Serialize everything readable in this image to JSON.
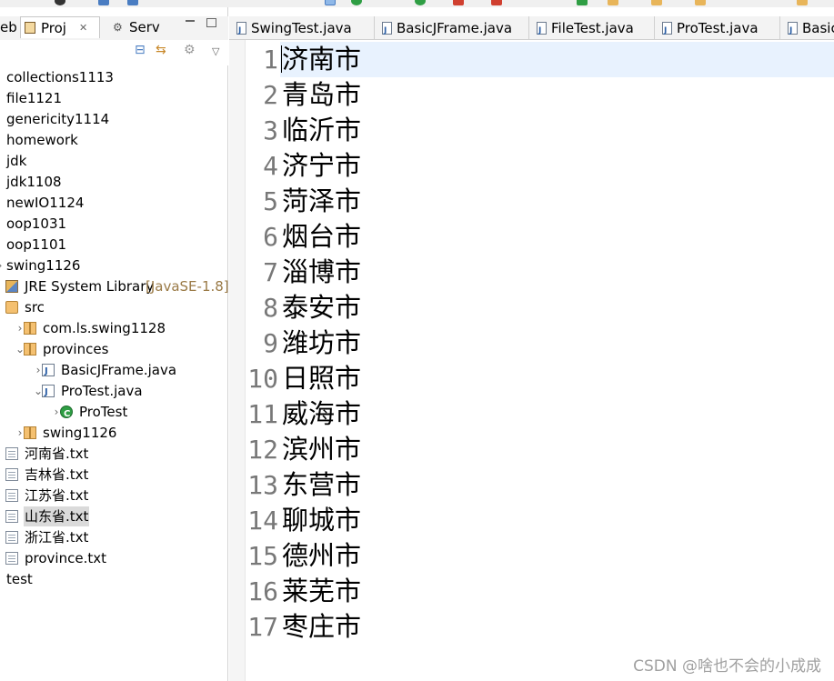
{
  "left_panel": {
    "tabs": [
      {
        "label": "eb"
      },
      {
        "label": "Proj",
        "close": "✕"
      },
      {
        "label": "Serv"
      }
    ],
    "tree": [
      {
        "label": "collections1113",
        "indent": 0,
        "icon": "none"
      },
      {
        "label": "file1121",
        "indent": 0,
        "icon": "none"
      },
      {
        "label": "genericity1114",
        "indent": 0,
        "icon": "none"
      },
      {
        "label": "homework",
        "indent": 0,
        "icon": "none"
      },
      {
        "label": "jdk",
        "indent": 0,
        "icon": "none"
      },
      {
        "label": "jdk1108",
        "indent": 0,
        "icon": "none"
      },
      {
        "label": "newIO1124",
        "indent": 0,
        "icon": "none"
      },
      {
        "label": "oop1031",
        "indent": 0,
        "icon": "none"
      },
      {
        "label": "oop1101",
        "indent": 0,
        "icon": "none"
      },
      {
        "label": "swing1126",
        "indent": 0,
        "icon": "none",
        "chevron": "›"
      },
      {
        "label": "JRE System Library",
        "decor": "[JavaSE-1.8]",
        "indent": 0,
        "icon": "library-icon"
      },
      {
        "label": "src",
        "indent": 0,
        "icon": "source-folder-icon"
      },
      {
        "label": "com.ls.swing1128",
        "indent": 1,
        "icon": "package-icon",
        "chevron": "›"
      },
      {
        "label": "provinces",
        "indent": 1,
        "icon": "package-icon",
        "chevron": "⌄"
      },
      {
        "label": "BasicJFrame.java",
        "indent": 2,
        "icon": "java-file-icon",
        "chevron": "›"
      },
      {
        "label": "ProTest.java",
        "indent": 2,
        "icon": "java-file-icon",
        "chevron": "⌄"
      },
      {
        "label": "ProTest",
        "indent": 3,
        "icon": "class-icon",
        "chevron": "›"
      },
      {
        "label": "swing1126",
        "indent": 1,
        "icon": "package-icon",
        "chevron": "›"
      },
      {
        "label": "河南省.txt",
        "indent": 0,
        "icon": "text-file-icon"
      },
      {
        "label": "吉林省.txt",
        "indent": 0,
        "icon": "text-file-icon"
      },
      {
        "label": "江苏省.txt",
        "indent": 0,
        "icon": "text-file-icon"
      },
      {
        "label": "山东省.txt",
        "indent": 0,
        "icon": "text-file-icon",
        "selected": true
      },
      {
        "label": "浙江省.txt",
        "indent": 0,
        "icon": "text-file-icon"
      },
      {
        "label": "province.txt",
        "indent": 0,
        "icon": "text-file-icon"
      },
      {
        "label": "test",
        "indent": 0,
        "icon": "none"
      }
    ]
  },
  "editor": {
    "tabs": [
      {
        "label": "SwingTest.java"
      },
      {
        "label": "BasicJFrame.java"
      },
      {
        "label": "FileTest.java"
      },
      {
        "label": "ProTest.java"
      },
      {
        "label": "Basic"
      }
    ],
    "lines": [
      {
        "num": "1",
        "text": "济南市"
      },
      {
        "num": "2",
        "text": "青岛市"
      },
      {
        "num": "3",
        "text": "临沂市"
      },
      {
        "num": "4",
        "text": "济宁市"
      },
      {
        "num": "5",
        "text": "菏泽市"
      },
      {
        "num": "6",
        "text": "烟台市"
      },
      {
        "num": "7",
        "text": "淄博市"
      },
      {
        "num": "8",
        "text": "泰安市"
      },
      {
        "num": "9",
        "text": "潍坊市"
      },
      {
        "num": "10",
        "text": "日照市"
      },
      {
        "num": "11",
        "text": "威海市"
      },
      {
        "num": "12",
        "text": "滨州市"
      },
      {
        "num": "13",
        "text": "东营市"
      },
      {
        "num": "14",
        "text": "聊城市"
      },
      {
        "num": "15",
        "text": "德州市"
      },
      {
        "num": "16",
        "text": "莱芜市"
      },
      {
        "num": "17",
        "text": "枣庄市"
      }
    ]
  },
  "watermark": "CSDN @啥也不会的小成成",
  "colors": {
    "current_line": "#e8f2fe",
    "line_number": "#787878",
    "selected_row": "#dadada"
  }
}
